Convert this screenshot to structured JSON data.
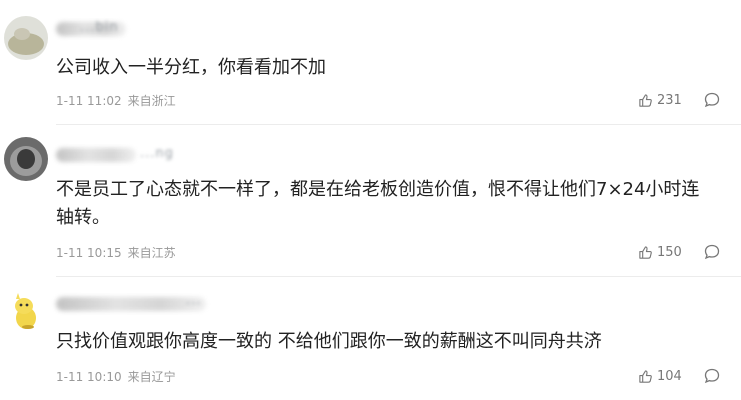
{
  "comments": [
    {
      "username": "...bin",
      "text": "公司收入一半分红，你看看加不加",
      "time": "1-11 11:02",
      "location": "来自浙江",
      "likes": "231",
      "like_icon": "thumbs-up-icon",
      "reply_icon": "comment-bubble-icon"
    },
    {
      "username": "...ng",
      "text": "不是员工了心态就不一样了，都是在给老板创造价值，恨不得让他们7×24小时连轴转。",
      "time": "1-11 10:15",
      "location": "来自江苏",
      "likes": "150",
      "like_icon": "thumbs-up-icon",
      "reply_icon": "comment-bubble-icon"
    },
    {
      "username": "...",
      "text": "只找价值观跟你高度一致的 不给他们跟你一致的薪酬这不叫同舟共济",
      "time": "1-11 10:10",
      "location": "来自辽宁",
      "likes": "104",
      "like_icon": "thumbs-up-icon",
      "reply_icon": "comment-bubble-icon"
    }
  ],
  "colors": {
    "text": "#222222",
    "meta": "#999999",
    "divider": "#ececec"
  }
}
